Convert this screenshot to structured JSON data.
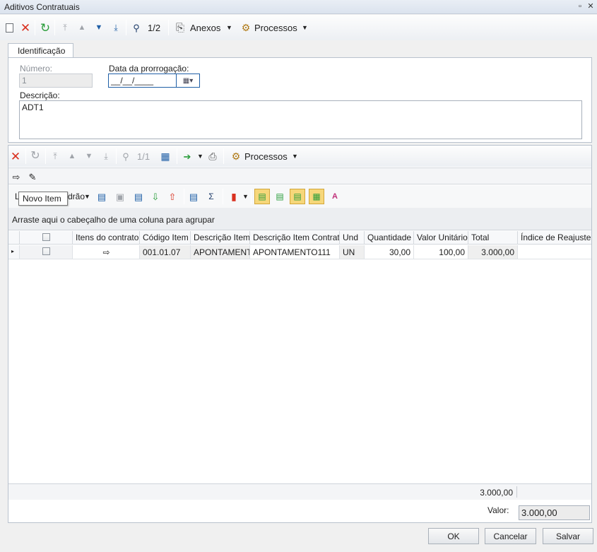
{
  "window": {
    "title": "Aditivos Contratuais"
  },
  "main_toolbar": {
    "record_position": "1/2",
    "anexos_label": "Anexos",
    "processos_label": "Processos"
  },
  "tabs": [
    {
      "label": "Identificação"
    }
  ],
  "form": {
    "numero_label": "Número:",
    "numero_value": "1",
    "data_label": "Data da prorrogação:",
    "data_value": "__/__/____",
    "descricao_label": "Descrição:",
    "descricao_value": "ADT1"
  },
  "grid_toolbar": {
    "record_position": "1/1",
    "processos_label": "Processos"
  },
  "layout_toolbar": {
    "layout_label_start": "L",
    "layout_label_end": "drão"
  },
  "tooltip": {
    "text": "Novo Item"
  },
  "grid": {
    "group_hint": "Arraste aqui o cabeçalho de uma coluna para agrupar",
    "columns": [
      "Itens do contrato",
      "Código Item",
      "Descrição Item",
      "Descrição Item Contrato",
      "Und",
      "Quantidade",
      "Valor Unitário",
      "Total",
      "Índice de Reajuste"
    ],
    "rows": [
      {
        "codigo": "001.01.07",
        "descricao": "APONTAMENTO",
        "descricao_contrato": "APONTAMENTO111",
        "und": "UN",
        "quantidade": "30,00",
        "valor_unitario": "100,00",
        "total": "3.000,00",
        "indice": ""
      }
    ],
    "footer_total": "3.000,00"
  },
  "valor": {
    "label": "Valor:",
    "value": "3.000,00"
  },
  "buttons": {
    "ok": "OK",
    "cancel": "Cancelar",
    "save": "Salvar"
  },
  "colors": {
    "accent": "#1f5fa6",
    "delete_red": "#d9301f",
    "refresh_green": "#2a9d3b",
    "highlight_yellow": "#f6d77a"
  }
}
